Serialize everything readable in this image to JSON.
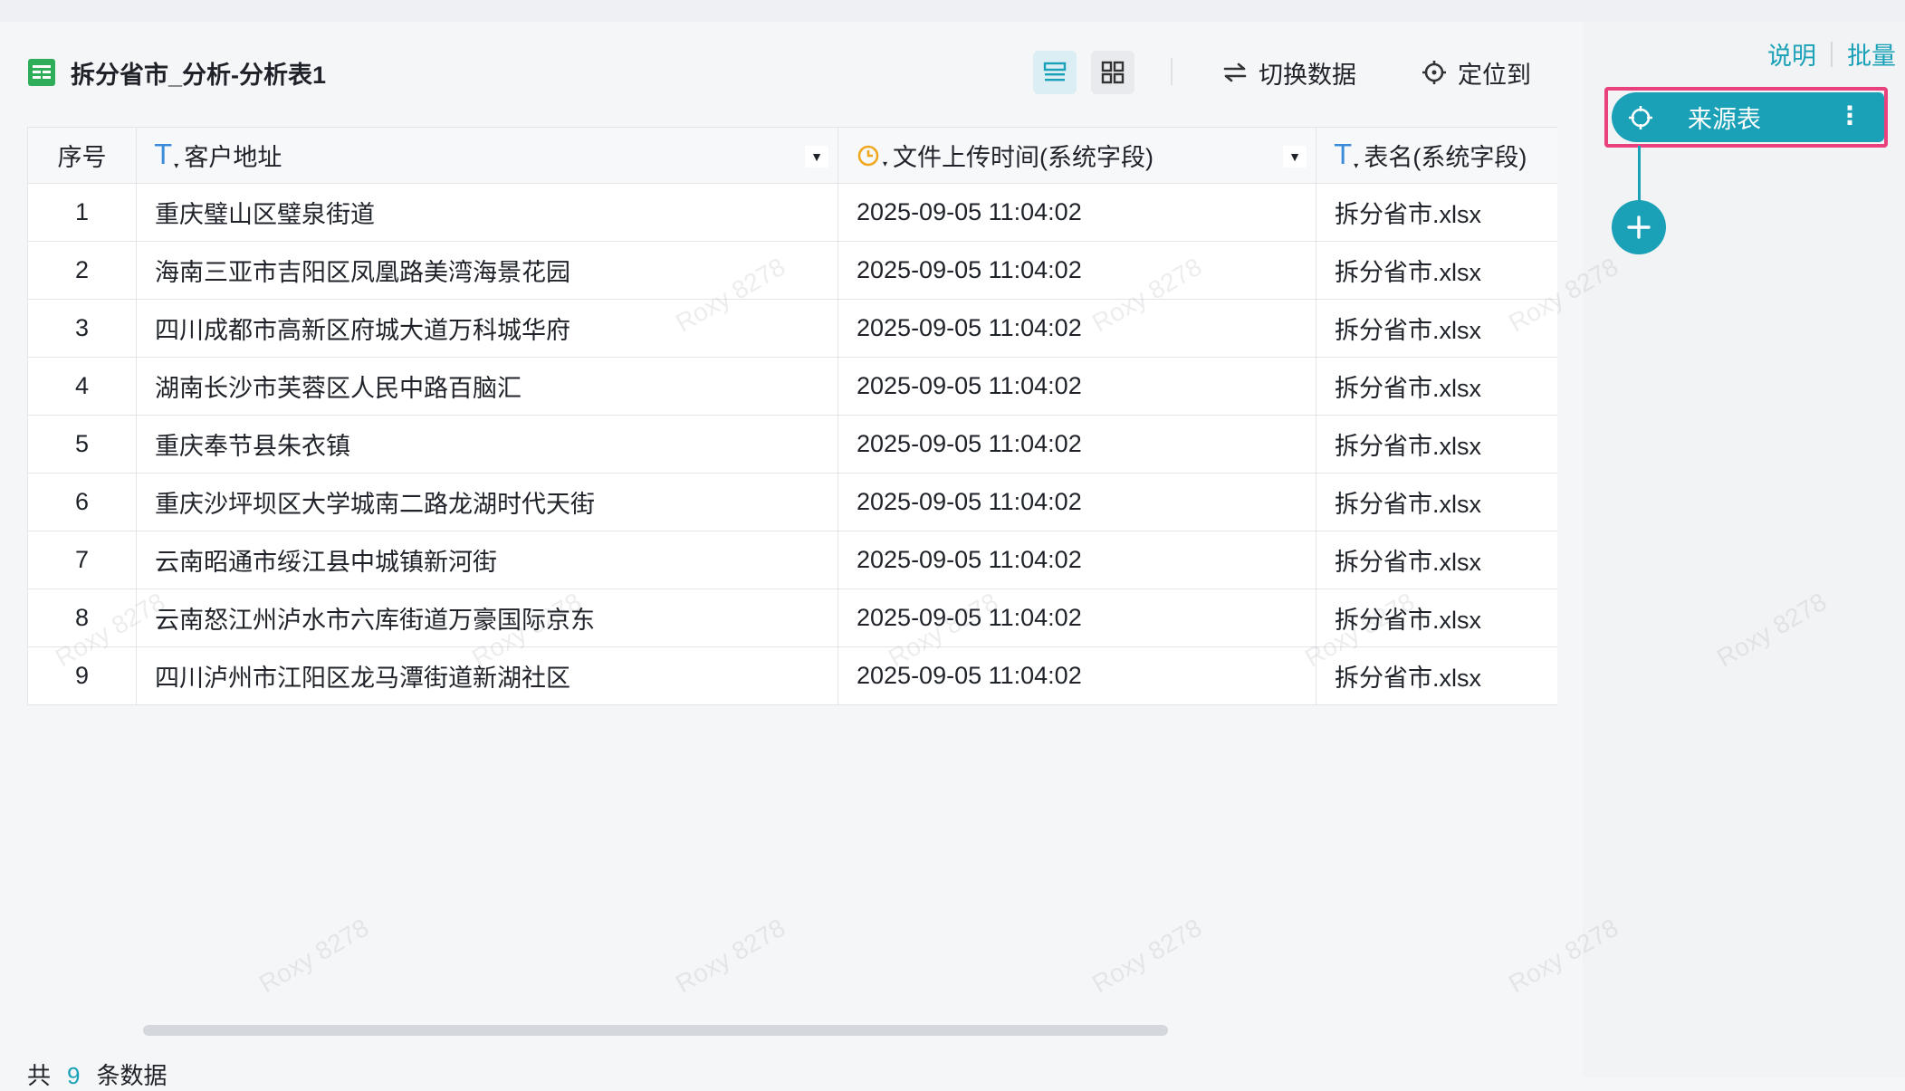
{
  "header": {
    "sheet_title": "拆分省市_分析-分析表1",
    "actions": {
      "switch_data": "切换数据",
      "locate": "定位到"
    }
  },
  "table": {
    "columns": [
      {
        "label": "序号",
        "type": "index"
      },
      {
        "label": "客户地址",
        "type": "text"
      },
      {
        "label": "文件上传时间(系统字段)",
        "type": "datetime"
      },
      {
        "label": "表名(系统字段)",
        "type": "text"
      }
    ],
    "rows": [
      {
        "index": "1",
        "address": "重庆璧山区璧泉街道",
        "upload_time": "2025-09-05 11:04:02",
        "table_name": "拆分省市.xlsx"
      },
      {
        "index": "2",
        "address": "海南三亚市吉阳区凤凰路美湾海景花园",
        "upload_time": "2025-09-05 11:04:02",
        "table_name": "拆分省市.xlsx"
      },
      {
        "index": "3",
        "address": "四川成都市高新区府城大道万科城华府",
        "upload_time": "2025-09-05 11:04:02",
        "table_name": "拆分省市.xlsx"
      },
      {
        "index": "4",
        "address": "湖南长沙市芙蓉区人民中路百脑汇",
        "upload_time": "2025-09-05 11:04:02",
        "table_name": "拆分省市.xlsx"
      },
      {
        "index": "5",
        "address": "重庆奉节县朱衣镇",
        "upload_time": "2025-09-05 11:04:02",
        "table_name": "拆分省市.xlsx"
      },
      {
        "index": "6",
        "address": "重庆沙坪坝区大学城南二路龙湖时代天街",
        "upload_time": "2025-09-05 11:04:02",
        "table_name": "拆分省市.xlsx"
      },
      {
        "index": "7",
        "address": "云南昭通市绥江县中城镇新河街",
        "upload_time": "2025-09-05 11:04:02",
        "table_name": "拆分省市.xlsx"
      },
      {
        "index": "8",
        "address": "云南怒江州泸水市六库街道万豪国际京东",
        "upload_time": "2025-09-05 11:04:02",
        "table_name": "拆分省市.xlsx"
      },
      {
        "index": "9",
        "address": "四川泸州市江阳区龙马潭街道新湖社区",
        "upload_time": "2025-09-05 11:04:02",
        "table_name": "拆分省市.xlsx"
      }
    ]
  },
  "footer": {
    "prefix": "共",
    "count": "9",
    "suffix": "条数据"
  },
  "side_panel": {
    "links": {
      "help": "说明",
      "batch": "批量"
    },
    "node_label": "来源表",
    "node_menu": "⋮"
  },
  "watermark": "Roxy 8278",
  "colors": {
    "accent": "#1aa1b8",
    "highlight_border": "#e8417d",
    "sheet_icon": "#2fae5a",
    "text_type_icon": "#3b8bd9",
    "date_type_icon": "#f0a81e"
  },
  "icons": [
    "sheet-icon",
    "list-view-icon",
    "grid-view-icon",
    "swap-icon",
    "locate-icon",
    "text-type-icon",
    "clock-icon",
    "dropdown-arrow-icon",
    "crosshair-icon",
    "more-icon",
    "plus-icon"
  ]
}
